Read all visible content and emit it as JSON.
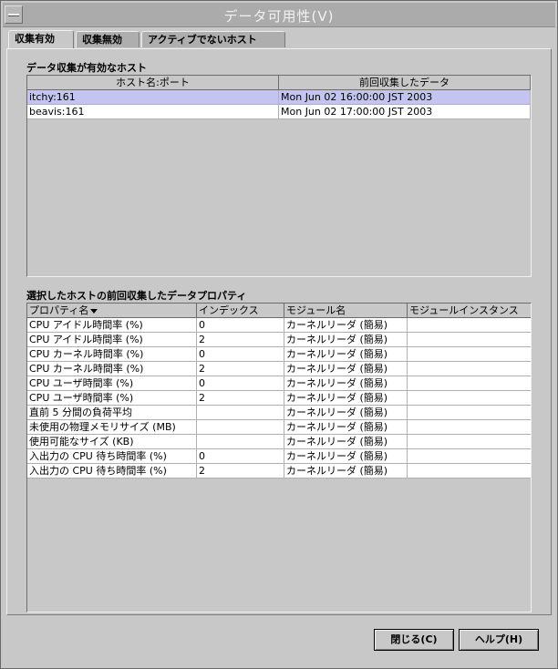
{
  "window": {
    "title": "データ可用性(V)"
  },
  "tabs": [
    {
      "label": "収集有効"
    },
    {
      "label": "収集無効"
    },
    {
      "label": "アクティブでないホスト"
    }
  ],
  "hosts": {
    "label": "データ収集が有効なホスト",
    "columns": [
      "ホスト名:ポート",
      "前回収集したデータ"
    ],
    "rows": [
      {
        "host": "itchy:161",
        "last": "Mon Jun 02 16:00:00 JST 2003"
      },
      {
        "host": "beavis:161",
        "last": "Mon Jun 02 17:00:00 JST 2003"
      }
    ]
  },
  "props": {
    "label": "選択したホストの前回収集したデータプロパティ",
    "columns": [
      "プロパティ名",
      "インデックス",
      "モジュール名",
      "モジュールインスタンス"
    ],
    "rows": [
      {
        "name": "CPU アイドル時間率 (%)",
        "index": "0",
        "module": "カーネルリーダ (簡易)",
        "instance": ""
      },
      {
        "name": "CPU アイドル時間率 (%)",
        "index": "2",
        "module": "カーネルリーダ (簡易)",
        "instance": ""
      },
      {
        "name": "CPU カーネル時間率 (%)",
        "index": "0",
        "module": "カーネルリーダ (簡易)",
        "instance": ""
      },
      {
        "name": "CPU カーネル時間率 (%)",
        "index": "2",
        "module": "カーネルリーダ (簡易)",
        "instance": ""
      },
      {
        "name": "CPU ユーザ時間率 (%)",
        "index": "0",
        "module": "カーネルリーダ (簡易)",
        "instance": ""
      },
      {
        "name": "CPU ユーザ時間率 (%)",
        "index": "2",
        "module": "カーネルリーダ (簡易)",
        "instance": ""
      },
      {
        "name": "直前 5 分間の負荷平均",
        "index": "",
        "module": "カーネルリーダ (簡易)",
        "instance": ""
      },
      {
        "name": "未使用の物理メモリサイズ (MB)",
        "index": "",
        "module": "カーネルリーダ (簡易)",
        "instance": ""
      },
      {
        "name": "使用可能なサイズ (KB)",
        "index": "",
        "module": "カーネルリーダ (簡易)",
        "instance": ""
      },
      {
        "name": "入出力の CPU 待ち時間率 (%)",
        "index": "0",
        "module": "カーネルリーダ (簡易)",
        "instance": ""
      },
      {
        "name": "入出力の CPU 待ち時間率 (%)",
        "index": "2",
        "module": "カーネルリーダ (簡易)",
        "instance": ""
      }
    ]
  },
  "buttons": {
    "close": "閉じる(C)",
    "help": "ヘルプ(H)"
  },
  "colors": {
    "selected_row": "#c4c4f2",
    "titlebar": "#ababab",
    "background": "#c8c8c8"
  }
}
